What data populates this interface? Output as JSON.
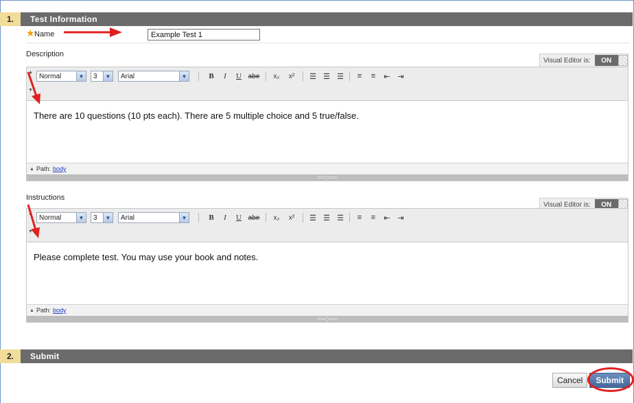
{
  "section1": {
    "number": "1.",
    "title": "Test Information"
  },
  "name_field": {
    "label": "Name",
    "value": "Example Test 1"
  },
  "description": {
    "label": "Description",
    "visual_editor_label": "Visual Editor is:",
    "visual_editor_state": "ON",
    "format": "Normal",
    "size": "3",
    "font": "Arial",
    "content": "There are 10 questions (10 pts each).  There are 5 multiple choice and 5 true/false.",
    "path_label": "Path:",
    "path_link": "body"
  },
  "instructions": {
    "label": "Instructions",
    "visual_editor_label": "Visual Editor is:",
    "visual_editor_state": "ON",
    "format": "Normal",
    "size": "3",
    "font": "Arial",
    "content": "Please complete test.  You may use your book and notes.",
    "path_label": "Path:",
    "path_link": "body"
  },
  "toolbar_buttons": {
    "bold": "B",
    "italic": "I",
    "underline": "U",
    "strike": "abe",
    "subscript": "x₂",
    "superscript": "x²",
    "align_left_icon": "align-left-icon",
    "align_center_icon": "align-center-icon",
    "align_right_icon": "align-right-icon",
    "ordered_list_icon": "ordered-list-icon",
    "unordered_list_icon": "unordered-list-icon",
    "outdent_icon": "outdent-icon",
    "indent_icon": "indent-icon"
  },
  "section2": {
    "number": "2.",
    "title": "Submit"
  },
  "actions": {
    "cancel": "Cancel",
    "submit": "Submit"
  },
  "colors": {
    "header_bar": "#6b6b6b",
    "step_number_bg": "#f2dc9a",
    "required_star": "#f0a000",
    "annotation_red": "#e02020",
    "submit_button": "#4f72a6"
  }
}
